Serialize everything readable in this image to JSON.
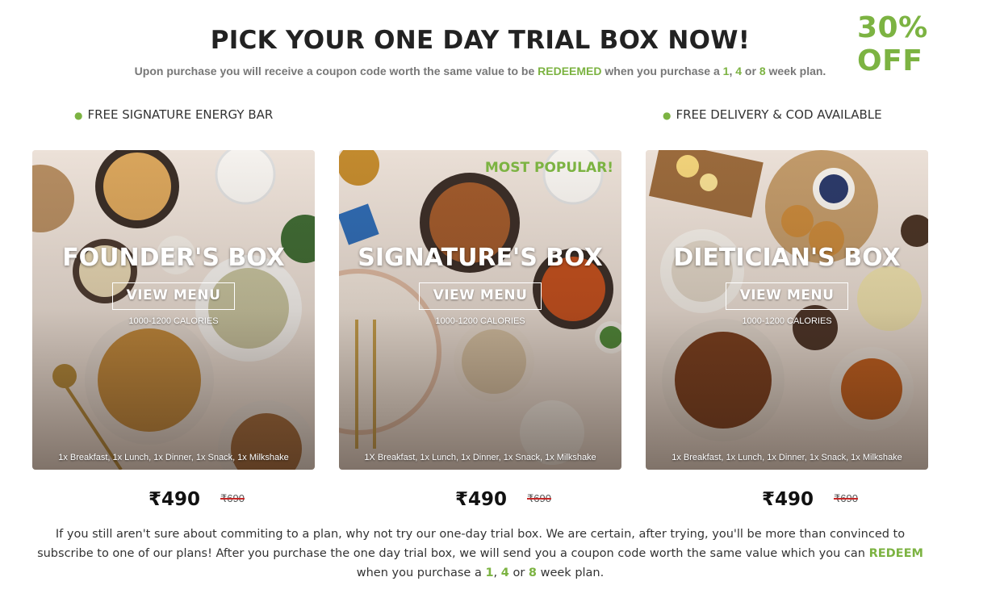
{
  "badge": "30% OFF",
  "headline": "PICK YOUR ONE DAY TRIAL BOX NOW!",
  "subline": {
    "part1": "Upon purchase you will receive a coupon code worth the same value to be ",
    "redeemed": "REDEEMED",
    "part2": " when you purchase a ",
    "n1": "1",
    "sep1": ", ",
    "n4": "4",
    "or": " or ",
    "n8": "8",
    "part3": " week plan."
  },
  "perks": {
    "left": "FREE SIGNATURE ENERGY BAR",
    "right": "FREE DELIVERY & COD AVAILABLE"
  },
  "cards": [
    {
      "title": "FOUNDER'S BOX",
      "button": "VIEW MENU",
      "calories": "1000-1200 CALORIES",
      "meals": "1x Breakfast, 1x Lunch, 1x Dinner, 1x Snack, 1x Milkshake",
      "price": "₹490",
      "old_price": "₹690"
    },
    {
      "title": "SIGNATURE'S BOX",
      "badge": "MOST POPULAR!",
      "button": "VIEW MENU",
      "calories": "1000-1200 CALORIES",
      "meals": "1X Breakfast, 1x Lunch, 1x Dinner, 1x Snack, 1x Milkshake",
      "price": "₹490",
      "old_price": "₹690"
    },
    {
      "title": "DIETICIAN'S BOX",
      "button": "VIEW MENU",
      "calories": "1000-1200 CALORIES",
      "meals": "1x Breakfast, 1x Lunch, 1x Dinner, 1x Snack, 1x Milkshake",
      "price": "₹490",
      "old_price": "₹690"
    }
  ],
  "footer": {
    "part1": "If you still aren't sure about commiting to a plan, why not try our one-day trial box. We are certain, after trying, you'll be more than convinced to subscribe to one of our plans! After you purchase the one day trial box, we will send you a coupon code worth the same value which you can ",
    "redeem": "REDEEM",
    "part2": " when you purchase a ",
    "n1": "1",
    "sep1": ", ",
    "n4": "4",
    "or": " or ",
    "n8": "8",
    "part3": " week plan."
  },
  "colors": {
    "accent": "#7cb342",
    "strike": "#c62828"
  }
}
